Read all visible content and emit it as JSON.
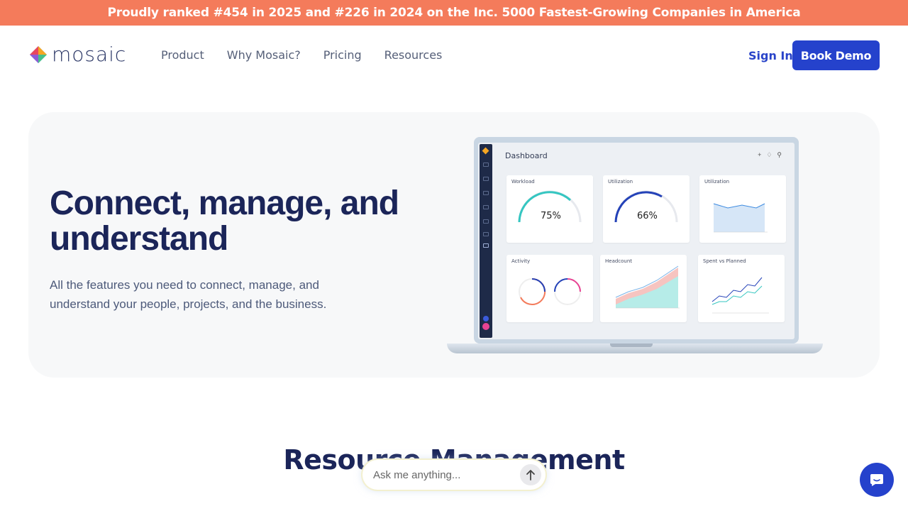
{
  "banner": {
    "text": "Proudly ranked #454 in 2025 and #226 in 2024 on the Inc. 5000 Fastest-Growing Companies in America"
  },
  "nav": {
    "logo_text": "mosaic",
    "links": [
      "Product",
      "Why Mosaic?",
      "Pricing",
      "Resources"
    ],
    "sign_in": "Sign In",
    "book_demo": "Book Demo"
  },
  "hero": {
    "heading": "Connect, manage, and understand",
    "subheading": "All the features you need to connect, manage, and understand your people, projects, and the business."
  },
  "dashboard": {
    "title": "Dashboard",
    "cards": [
      {
        "title": "Workload",
        "value": "75%",
        "level": 0.75
      },
      {
        "title": "Utilization",
        "value": "66%",
        "level": 0.66
      },
      {
        "title": "Utilization"
      },
      {
        "title": "Activity"
      },
      {
        "title": "Headcount"
      },
      {
        "title": "Spent vs Planned"
      }
    ]
  },
  "section": {
    "title": "Resource Management"
  },
  "ask": {
    "placeholder": "Ask me anything..."
  },
  "colors": {
    "banner": "#f47b5b",
    "primary": "#2542cc",
    "heading": "#1b2559"
  }
}
